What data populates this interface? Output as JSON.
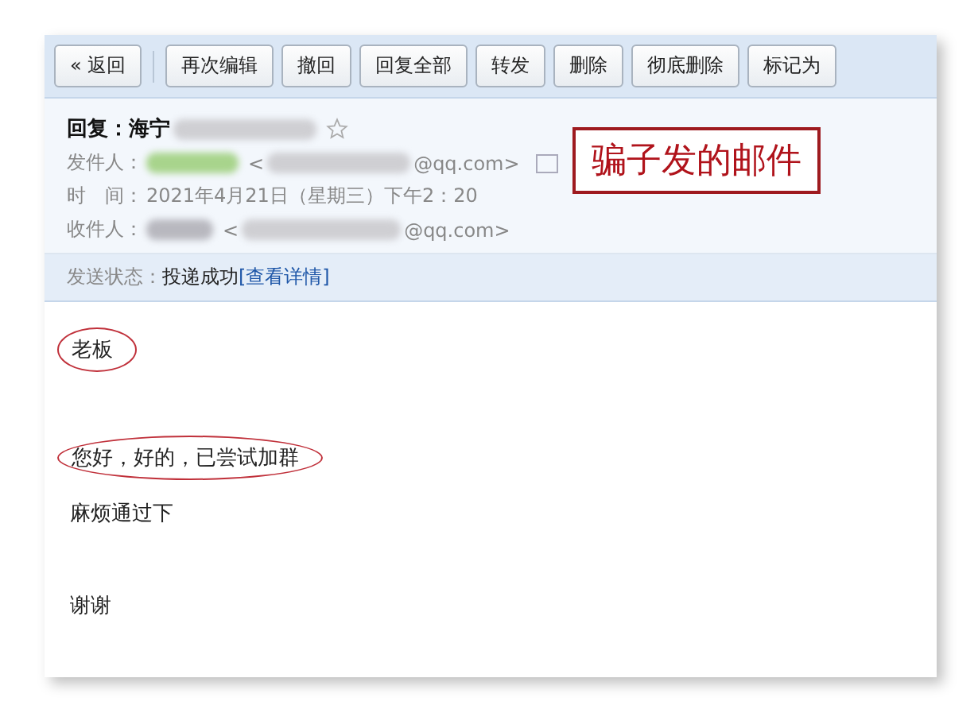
{
  "toolbar": {
    "back": "« 返回",
    "buttons": [
      "再次编辑",
      "撤回",
      "回复全部",
      "转发",
      "删除",
      "彻底删除",
      "标记为"
    ]
  },
  "header": {
    "subject": "回复：海宁",
    "starred": false,
    "fields": [
      {
        "label": "发件人：",
        "open": "<",
        "domain": "@qq.com>",
        "card": true
      },
      {
        "label": "收件人：",
        "open": "<",
        "domain": "@qq.com>",
        "card": false
      }
    ],
    "time": {
      "label": "时　间：",
      "value": "2021年4月21日（星期三）下午2：20"
    }
  },
  "status": {
    "label": "发送状态：",
    "value": "投递成功",
    "link": "[查看详情]"
  },
  "annotation": "骗子发的邮件",
  "body": [
    {
      "text": "老板",
      "circled": true,
      "kind": "greeting"
    },
    {
      "text": "您好，好的，已尝试加群",
      "circled": true,
      "kind": "line"
    },
    {
      "text": "麻烦通过下",
      "circled": false,
      "kind": "line"
    },
    {
      "text": "谢谢",
      "circled": false,
      "kind": "signoff"
    }
  ]
}
